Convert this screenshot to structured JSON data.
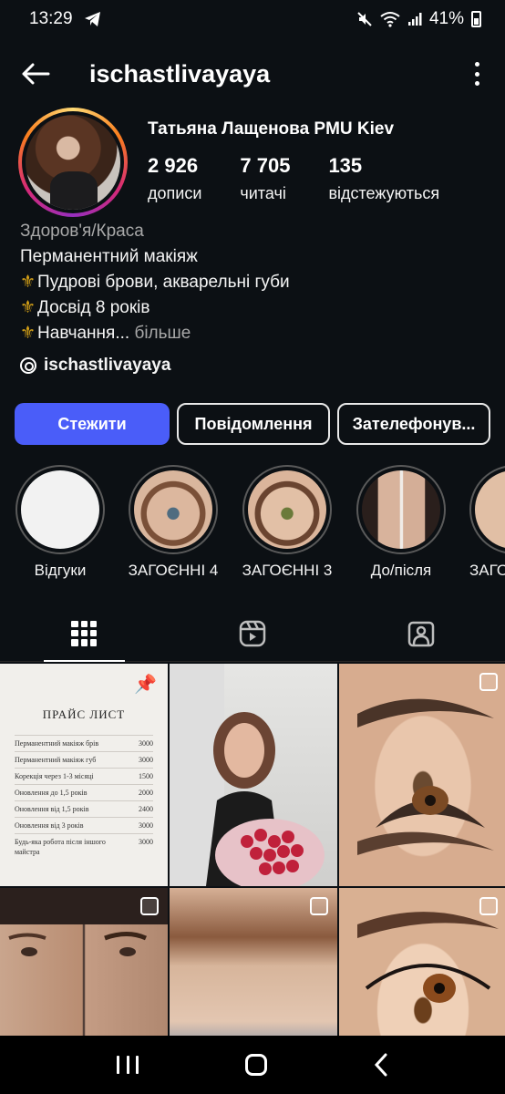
{
  "status_bar": {
    "time": "13:29",
    "battery": "41%"
  },
  "header": {
    "username": "ischastlivayaya"
  },
  "profile": {
    "full_name": "Татьяна Лащенова PMU Kiev",
    "stats": [
      {
        "value": "2 926",
        "label": "дописи"
      },
      {
        "value": "7 705",
        "label": "читачі"
      },
      {
        "value": "135",
        "label": "відстежуються"
      }
    ],
    "category": "Здоров'я/Краса",
    "bio_line1": "Перманентний макіяж",
    "bio_line2": "Пудрові брови, акварельні губи",
    "bio_line3": "Досвід 8 років",
    "bio_line4": "Навчання...",
    "more_label": "більше",
    "threads_handle": "ischastlivayaya"
  },
  "buttons": {
    "follow": "Стежити",
    "message": "Повідомлення",
    "call": "Зателефонув..."
  },
  "highlights": [
    {
      "label": "Відгуки"
    },
    {
      "label": "ЗАГОЄННІ 4"
    },
    {
      "label": "ЗАГОЄННІ 3"
    },
    {
      "label": "До/після"
    },
    {
      "label": "ЗАГОЄ"
    }
  ],
  "price_list": {
    "title": "ПРАЙС ЛИСТ",
    "rows": [
      {
        "name": "Перманентний макіяж брів",
        "price": "3000"
      },
      {
        "name": "Перманентний макіяж губ",
        "price": "3000"
      },
      {
        "name": "Корекція через 1-3 місяці",
        "price": "1500"
      },
      {
        "name": "Оновлення до 1,5 років",
        "price": "2000"
      },
      {
        "name": "Оновлення від 1,5 років",
        "price": "2400"
      },
      {
        "name": "Оновлення від 3 років",
        "price": "3000"
      },
      {
        "name": "Будь-яка робота після іншого майстра",
        "price": "3000"
      }
    ]
  }
}
